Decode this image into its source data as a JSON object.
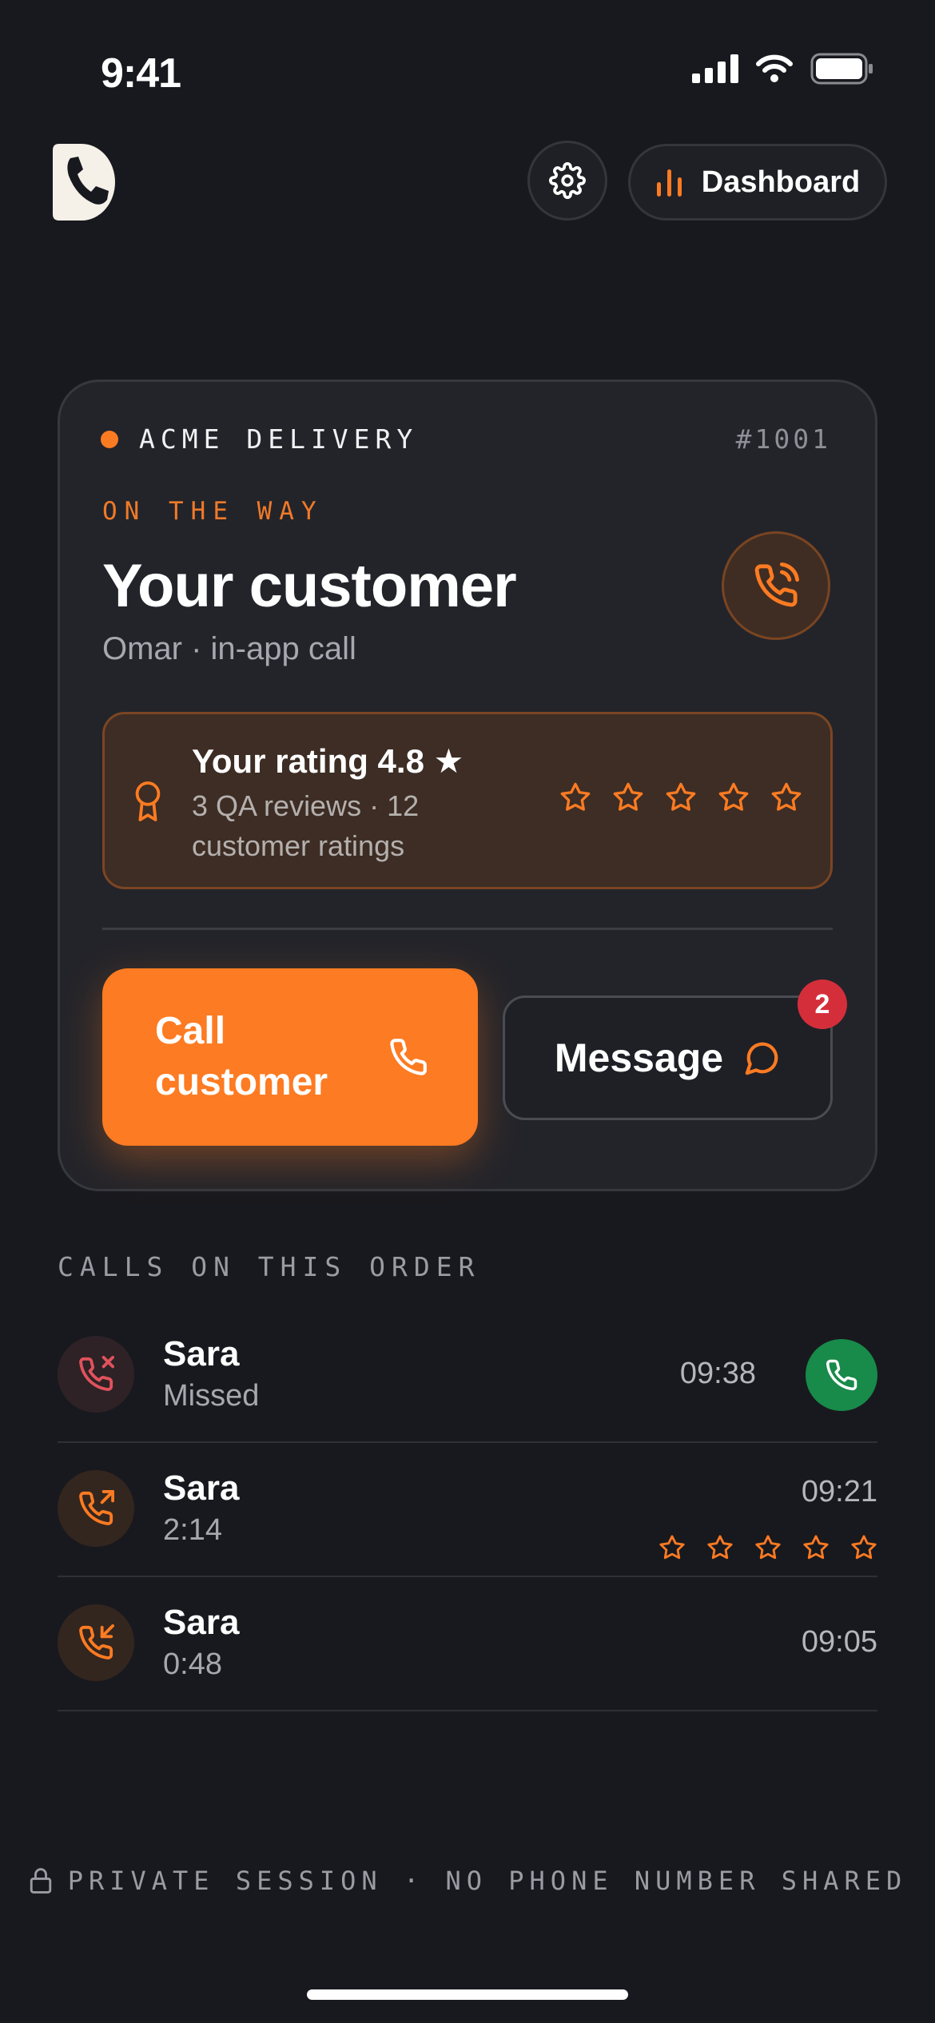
{
  "status_bar": {
    "time": "9:41"
  },
  "header": {
    "logo_icon": "phone-logo-icon",
    "settings_icon": "gear-icon",
    "dashboard_label": "Dashboard",
    "dashboard_icon": "bar-chart-icon"
  },
  "card": {
    "brand": "ACME DELIVERY",
    "order_id": "#1001",
    "status": "ON THE WAY",
    "title": "Your customer",
    "subtitle": "Omar · in-app call",
    "rating": {
      "title": "Your rating 4.8 ★",
      "subtitle": "3 QA reviews · 12 customer ratings",
      "stars_total": 5,
      "stars_filled": 0
    },
    "call_button": "Call customer",
    "message_button": "Message",
    "message_badge": "2"
  },
  "calls": {
    "section_label": "CALLS ON THIS ORDER",
    "items": [
      {
        "name": "Sara",
        "detail": "Missed",
        "time": "09:38",
        "type": "missed",
        "icon": "phone-missed-icon"
      },
      {
        "name": "Sara",
        "detail": "2:14",
        "time": "09:21",
        "type": "outgoing",
        "icon": "phone-outgoing-icon",
        "stars_total": 5,
        "stars_filled": 0
      },
      {
        "name": "Sara",
        "detail": "0:48",
        "time": "09:05",
        "type": "incoming",
        "icon": "phone-incoming-icon"
      }
    ]
  },
  "footer": {
    "text": "PRIVATE SESSION · NO PHONE NUMBER SHARED",
    "icon": "lock-icon"
  },
  "colors": {
    "background": "#18191e",
    "accent": "#fd7b22",
    "missed": "#e0525c",
    "callback": "#188a4a",
    "badge": "#d52e3b"
  }
}
